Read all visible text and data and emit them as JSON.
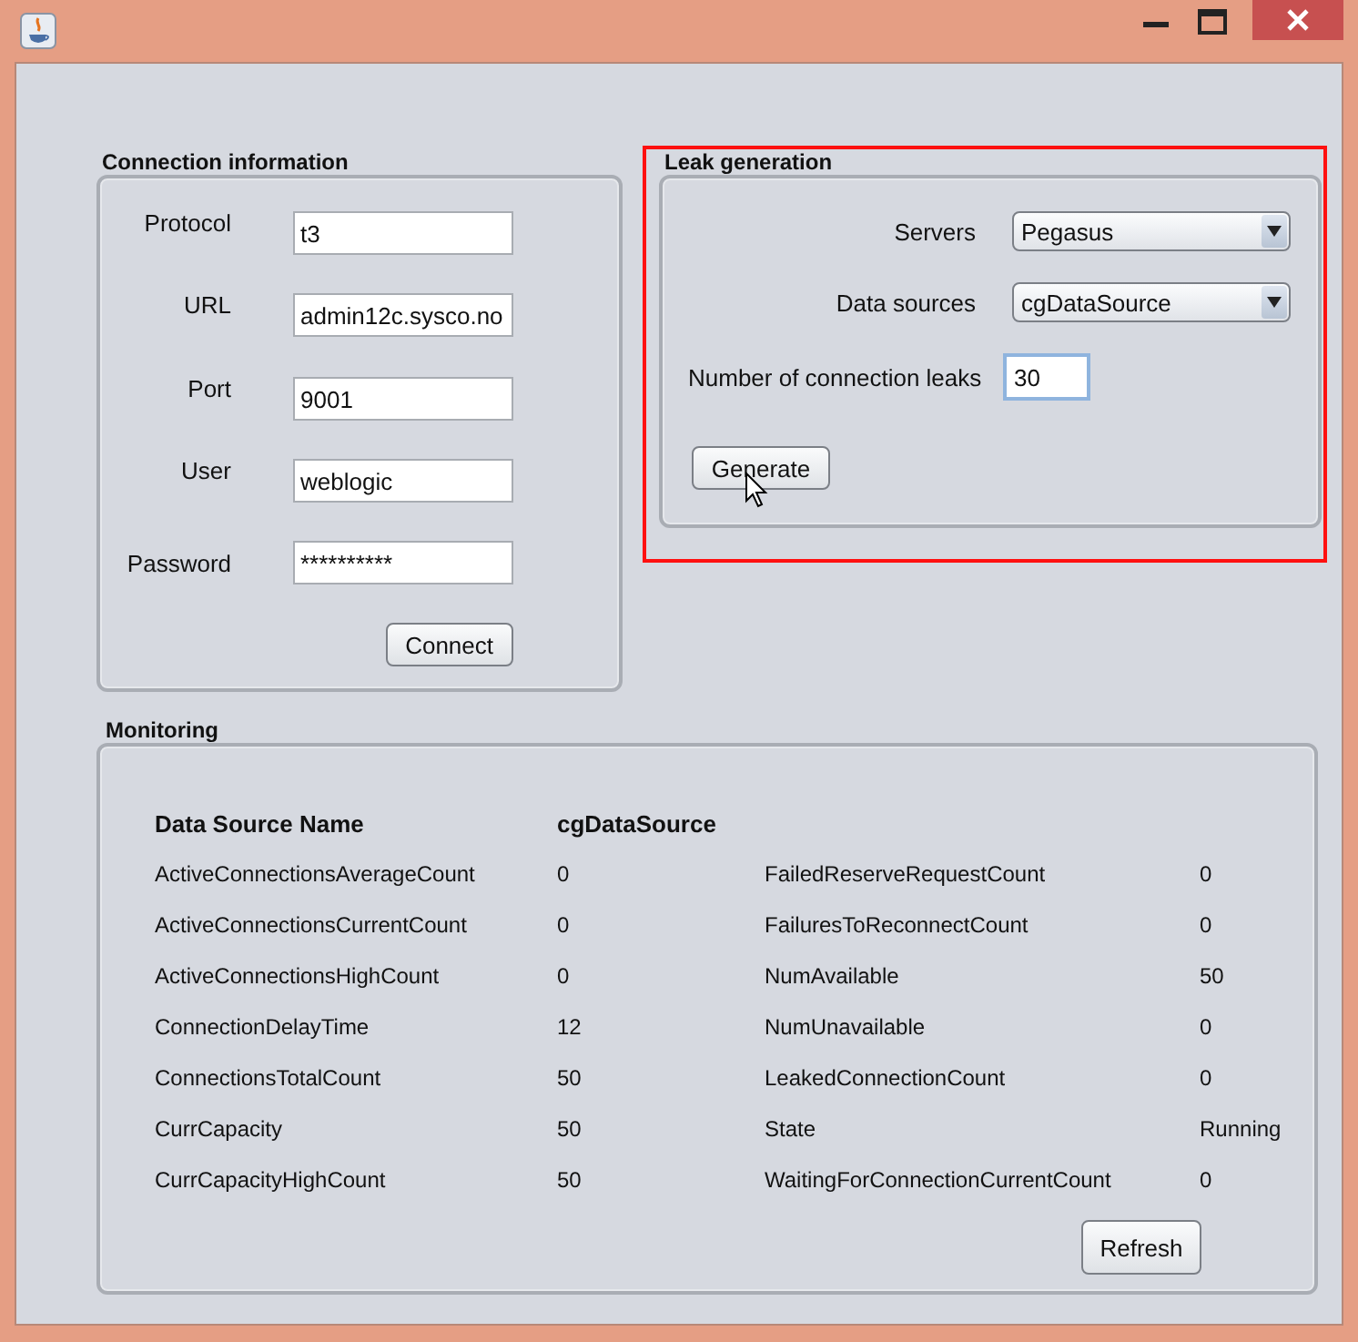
{
  "connection": {
    "title": "Connection information",
    "fields": [
      {
        "label": "Protocol",
        "value": "t3"
      },
      {
        "label": "URL",
        "value": "admin12c.sysco.no"
      },
      {
        "label": "Port",
        "value": "9001"
      },
      {
        "label": "User",
        "value": "weblogic"
      },
      {
        "label": "Password",
        "value": "**********"
      }
    ],
    "button": "Connect"
  },
  "leak": {
    "title": "Leak generation",
    "highlighted": true,
    "selects": [
      {
        "label": "Servers",
        "value": "Pegasus"
      },
      {
        "label": "Data sources",
        "value": "cgDataSource"
      }
    ],
    "count": {
      "label": "Number of connection leaks",
      "value": "30",
      "focused": true
    },
    "button": "Generate"
  },
  "monitoring": {
    "title": "Monitoring",
    "header": {
      "name": "Data Source Name",
      "value": "cgDataSource"
    },
    "rows": [
      {
        "left_name": "ActiveConnectionsAverageCount",
        "left_value": "0",
        "right_name": "FailedReserveRequestCount",
        "right_value": "0"
      },
      {
        "left_name": "ActiveConnectionsCurrentCount",
        "left_value": "0",
        "right_name": "FailuresToReconnectCount",
        "right_value": "0"
      },
      {
        "left_name": "ActiveConnectionsHighCount",
        "left_value": "0",
        "right_name": "NumAvailable",
        "right_value": "50"
      },
      {
        "left_name": "ConnectionDelayTime",
        "left_value": "12",
        "right_name": "NumUnavailable",
        "right_value": "0"
      },
      {
        "left_name": "ConnectionsTotalCount",
        "left_value": "50",
        "right_name": "LeakedConnectionCount",
        "right_value": "0"
      },
      {
        "left_name": "CurrCapacity",
        "left_value": "50",
        "right_name": "State",
        "right_value": "Running"
      },
      {
        "left_name": "CurrCapacityHighCount",
        "left_value": "50",
        "right_name": "WaitingForConnectionCurrentCount",
        "right_value": "0"
      }
    ],
    "button": "Refresh"
  }
}
